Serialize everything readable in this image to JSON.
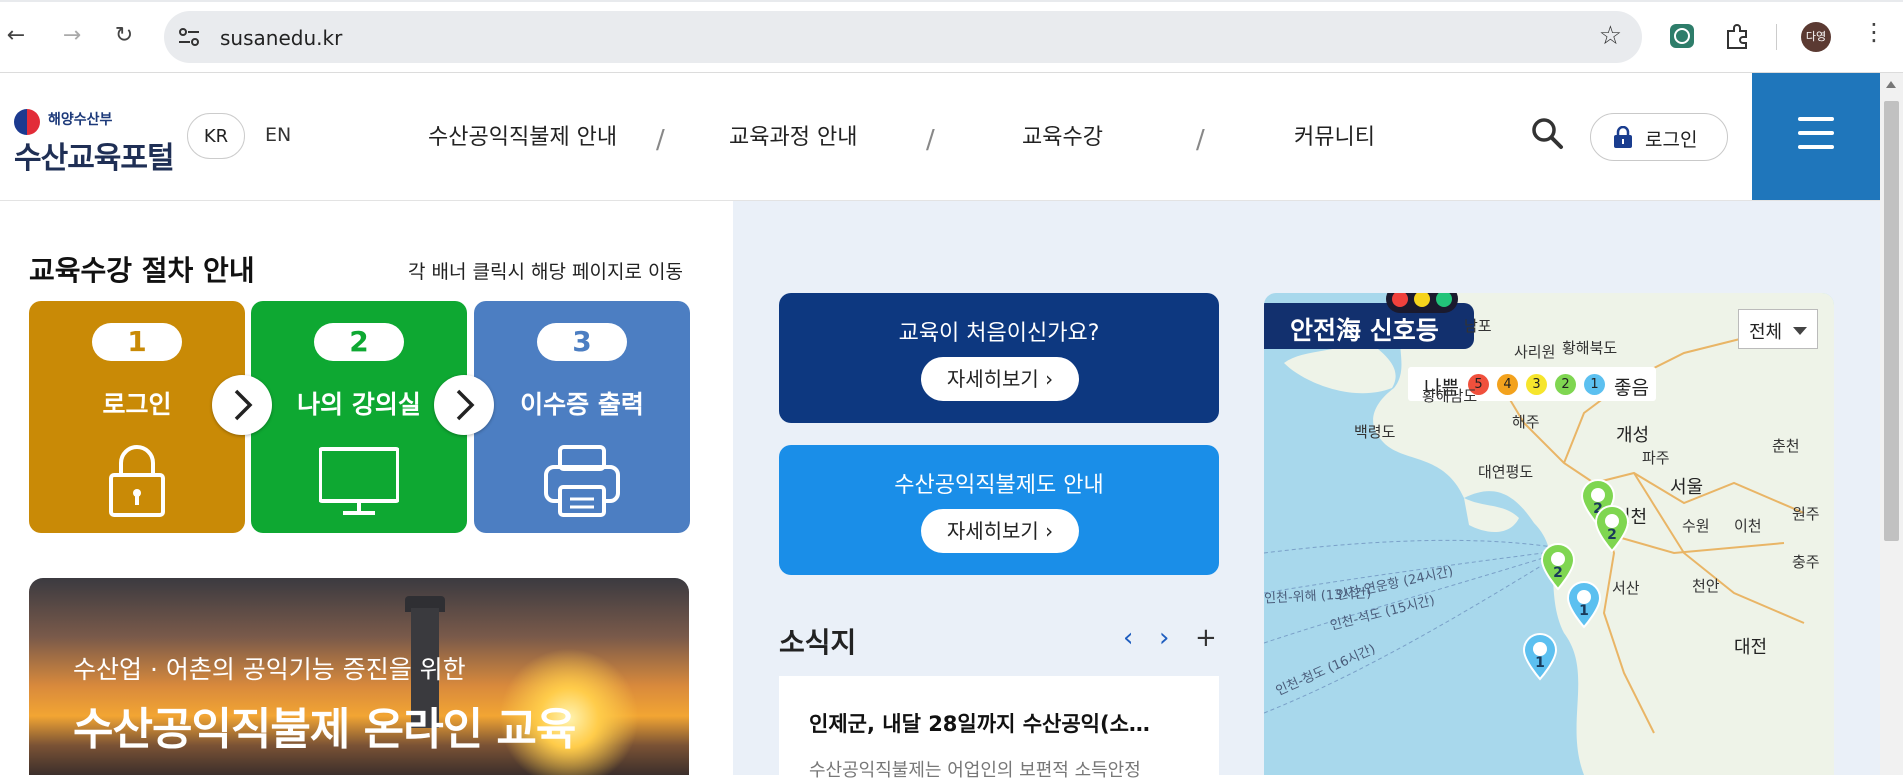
{
  "browser": {
    "url": "susanedu.kr",
    "profile_initials": "다영"
  },
  "header": {
    "ministry": "해양수산부",
    "portal_name": "수산교육포털",
    "lang_kr": "KR",
    "lang_en": "EN",
    "nav": [
      "수산공익직불제 안내",
      "교육과정 안내",
      "교육수강",
      "커뮤니티"
    ],
    "nav_separator": "/",
    "login_label": "로그인"
  },
  "procedure": {
    "title": "교육수강 절차 안내",
    "hint": "각 배너 클릭시 해당 페이지로 이동",
    "steps": [
      {
        "number": "1",
        "label": "로그인",
        "color": "#c98a06",
        "icon": "lock-icon"
      },
      {
        "number": "2",
        "label": "나의 강의실",
        "color": "#0ea832",
        "icon": "monitor-icon"
      },
      {
        "number": "3",
        "label": "이수증 출력",
        "color": "#4c7ec2",
        "icon": "printer-icon"
      }
    ]
  },
  "banner": {
    "subtitle": "수산업 · 어촌의 공익기능 증진을 위한",
    "title": "수산공익직불제 온라인 교육"
  },
  "cta": [
    {
      "question": "교육이 처음이신가요?",
      "button": "자세히보기 ›",
      "color": "#0d3880"
    },
    {
      "question": "수산공익직불제도 안내",
      "button": "자세히보기 ›",
      "color": "#1a8ee8"
    }
  ],
  "news": {
    "title": "소식지",
    "prev": "‹",
    "next": "›",
    "more": "+",
    "headline": "인제군, 내달 28일까지 수산공익(소…",
    "excerpt": "수산공익직불제는 어업인의 보편적 소득안정"
  },
  "signal_map": {
    "title": "안전海 신호등",
    "filter": "전체",
    "legend_bad": "나쁨",
    "legend_good": "좋음",
    "levels": [
      {
        "label": "5",
        "color": "#f0503c"
      },
      {
        "label": "4",
        "color": "#f3a21d"
      },
      {
        "label": "3",
        "color": "#f6e52c"
      },
      {
        "label": "2",
        "color": "#7fd651"
      },
      {
        "label": "1",
        "color": "#5cc0f0"
      }
    ],
    "places": [
      "남포",
      "사리원",
      "황해북도",
      "황해남도",
      "해주",
      "백령도",
      "개성",
      "파주",
      "춘천",
      "대연평도",
      "서울",
      "인천",
      "수원",
      "이천",
      "원주",
      "서산",
      "천안",
      "충주",
      "대전"
    ],
    "routes": [
      "인천-위해 (13시간)",
      "인천-연운항 (24시간)",
      "인천-석도 (15시간)",
      "인천-청도 (16시간)"
    ],
    "pins": [
      {
        "level": "2",
        "color": "#7fd651"
      },
      {
        "level": "2",
        "color": "#7fd651"
      },
      {
        "level": "2",
        "color": "#7fd651"
      },
      {
        "level": "1",
        "color": "#5cc0f0"
      },
      {
        "level": "1",
        "color": "#5cc0f0"
      }
    ]
  }
}
